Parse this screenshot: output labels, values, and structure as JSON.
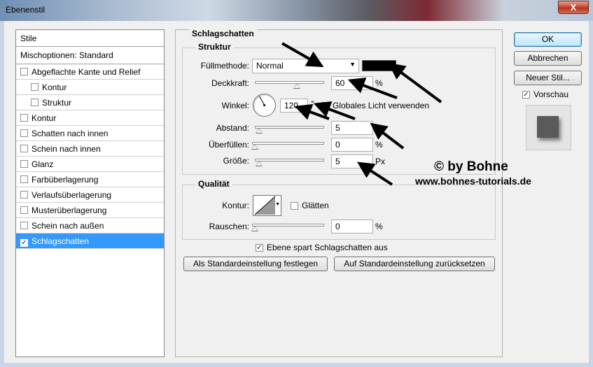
{
  "window": {
    "title": "Ebenenstil",
    "close_label": "X"
  },
  "left_panel": {
    "header": "Stile",
    "blend_options": "Mischoptionen: Standard",
    "items": [
      {
        "label": "Abgeflachte Kante und Relief",
        "checked": false,
        "sub": false
      },
      {
        "label": "Kontur",
        "checked": false,
        "sub": true
      },
      {
        "label": "Struktur",
        "checked": false,
        "sub": true
      },
      {
        "label": "Kontur",
        "checked": false,
        "sub": false
      },
      {
        "label": "Schatten nach innen",
        "checked": false,
        "sub": false
      },
      {
        "label": "Schein nach innen",
        "checked": false,
        "sub": false
      },
      {
        "label": "Glanz",
        "checked": false,
        "sub": false
      },
      {
        "label": "Farbüberlagerung",
        "checked": false,
        "sub": false
      },
      {
        "label": "Verlaufsüberlagerung",
        "checked": false,
        "sub": false
      },
      {
        "label": "Musterüberlagerung",
        "checked": false,
        "sub": false
      },
      {
        "label": "Schein nach außen",
        "checked": false,
        "sub": false
      },
      {
        "label": "Schlagschatten",
        "checked": true,
        "sub": false,
        "selected": true
      }
    ]
  },
  "main": {
    "section_title": "Schlagschatten",
    "structure": {
      "title": "Struktur",
      "blend_mode_label": "Füllmethode:",
      "blend_mode_value": "Normal",
      "shadow_color": "#000000",
      "opacity_label": "Deckkraft:",
      "opacity_value": "60",
      "opacity_unit": "%",
      "angle_label": "Winkel:",
      "angle_value": "120",
      "angle_unit": "°",
      "global_light_label": "Globales Licht verwenden",
      "global_light_checked": false,
      "distance_label": "Abstand:",
      "distance_value": "5",
      "distance_unit": "Px",
      "spread_label": "Überfüllen:",
      "spread_value": "0",
      "spread_unit": "%",
      "size_label": "Größe:",
      "size_value": "5",
      "size_unit": "Px"
    },
    "quality": {
      "title": "Qualität",
      "contour_label": "Kontur:",
      "antialias_label": "Glätten",
      "antialias_checked": false,
      "noise_label": "Rauschen:",
      "noise_value": "0",
      "noise_unit": "%"
    },
    "knockout_label": "Ebene spart Schlagschatten aus",
    "knockout_checked": true,
    "make_default_label": "Als Standardeinstellung festlegen",
    "reset_default_label": "Auf Standardeinstellung zurücksetzen"
  },
  "buttons": {
    "ok": "OK",
    "cancel": "Abbrechen",
    "new_style": "Neuer Stil...",
    "preview_label": "Vorschau",
    "preview_checked": true
  },
  "watermark": {
    "line1": "© by Bohne",
    "line2": "www.bohnes-tutorials.de"
  }
}
